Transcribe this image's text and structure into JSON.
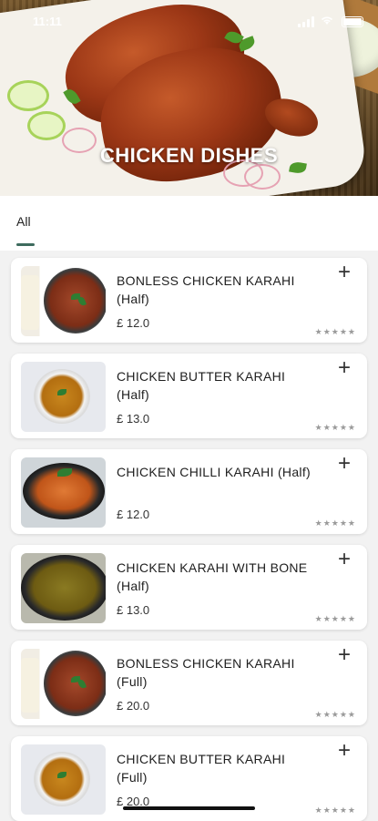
{
  "status_bar": {
    "time": "11:11"
  },
  "hero": {
    "title": "CHICKEN DISHES"
  },
  "tabs": [
    {
      "label": "All",
      "active": true
    }
  ],
  "items": [
    {
      "name": "BONLESS CHICKEN KARAHI (Half)",
      "price": "£ 12.0",
      "rating": "★★★★★",
      "image": "karahi"
    },
    {
      "name": "CHICKEN BUTTER KARAHI (Half)",
      "price": "£ 13.0",
      "rating": "★★★★★",
      "image": "butter"
    },
    {
      "name": "CHICKEN CHILLI KARAHI (Half)",
      "price": "£ 12.0",
      "rating": "★★★★★",
      "image": "chilli"
    },
    {
      "name": "CHICKEN KARAHI WITH BONE (Half)",
      "price": "£ 13.0",
      "rating": "★★★★★",
      "image": "bone"
    },
    {
      "name": "BONLESS CHICKEN KARAHI (Full)",
      "price": "£ 20.0",
      "rating": "★★★★★",
      "image": "karahi"
    },
    {
      "name": "CHICKEN BUTTER KARAHI (Full)",
      "price": "£ 20.0",
      "rating": "★★★★★",
      "image": "butter"
    }
  ],
  "icons": {
    "add": "plus-icon",
    "rating": "star-icon"
  },
  "colors": {
    "tab_indicator": "#3e6b5e",
    "card_bg": "#ffffff",
    "page_bg": "#f2f2f2"
  }
}
